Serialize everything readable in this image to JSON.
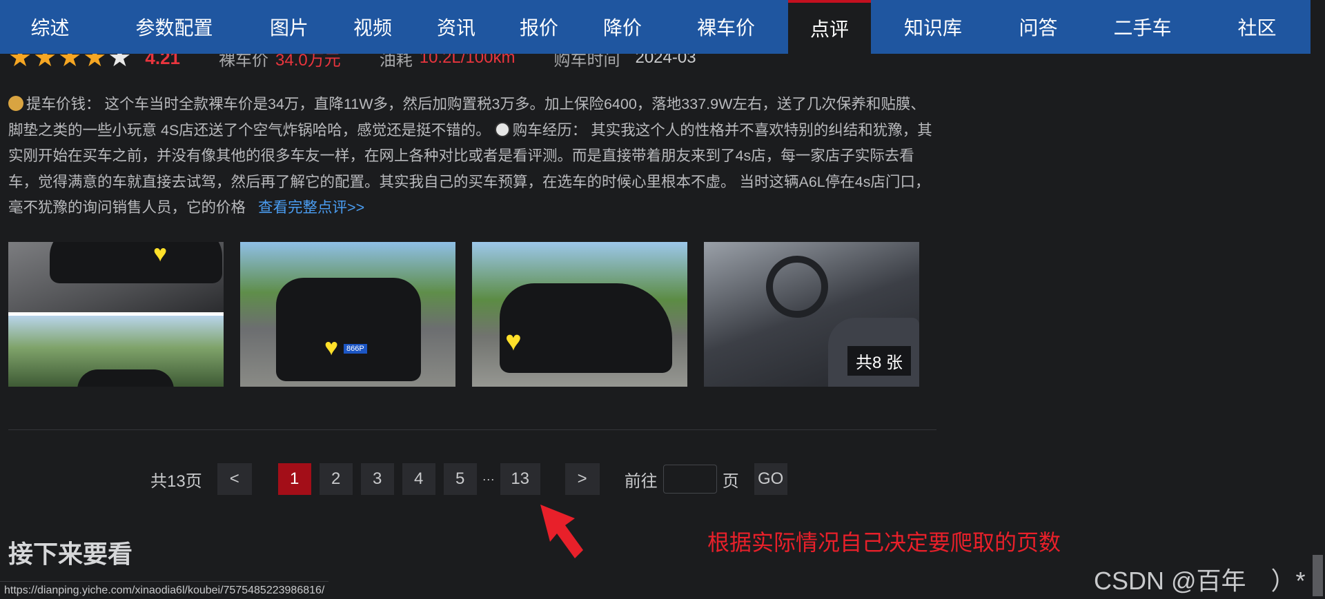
{
  "nav": {
    "items": [
      {
        "label": "综述",
        "width": 145
      },
      {
        "label": "参数配置",
        "width": 215
      },
      {
        "label": "图片",
        "width": 118
      },
      {
        "label": "视频",
        "width": 124
      },
      {
        "label": "资讯",
        "width": 118
      },
      {
        "label": "报价",
        "width": 122
      },
      {
        "label": "降价",
        "width": 120
      },
      {
        "label": "裸车价",
        "width": 180
      },
      {
        "label": "点评",
        "width": 120,
        "active": true
      },
      {
        "label": "知识库",
        "width": 180
      },
      {
        "label": "问答",
        "width": 125
      },
      {
        "label": "二手车",
        "width": 177
      },
      {
        "label": "社区",
        "width": 155
      }
    ]
  },
  "review": {
    "score": "4.21",
    "price_label": "裸车价",
    "price_value": "34.0万元",
    "fuel_label": "油耗",
    "fuel_value": "10.2L/100km",
    "date_label": "购车时间",
    "date_value": "2024-03",
    "text_part1": "提车价钱： 这个车当时全款裸车价是34万，直降11W多，然后加购置税3万多。加上保险6400，落地337.9W左右，送了几次保养和贴膜、脚垫之类的一些小玩意 4S店还送了个空气炸锅哈哈，感觉还是挺不错的。",
    "text_part2": "购车经历： 其实我这个人的性格并不喜欢特别的纠结和犹豫，其实刚开始在买车之前，并没有像其他的很多车友一样，在网上各种对比或者是看评测。而是直接带着朋友来到了4s店，每一家店子实际去看车，觉得满意的车就直接去试驾，然后再了解它的配置。其实我自己的买车预算，在选车的时候心里根本不虚。 当时这辆A6L停在4s店门口，毫不犹豫的询问销售人员，它的价格",
    "more_link": "查看完整点评>>",
    "photo_count": "共8 张",
    "plate_text": "866P"
  },
  "pagination": {
    "total": "共13页",
    "prev": "<",
    "pages": [
      "1",
      "2",
      "3",
      "4",
      "5"
    ],
    "ellipsis": "···",
    "last": "13",
    "next": ">",
    "goto_label": "前往",
    "page_unit": "页",
    "go": "GO"
  },
  "next_section_title": "接下来要看",
  "annotation_text": "根据实际情况自己决定要爬取的页数",
  "status_url": "https://dianping.yiche.com/xinaodia6l/koubei/7575485223986816/",
  "watermark": "CSDN @百年　）*",
  "colors": {
    "nav_bg": "#1f56a0",
    "active_top": "#c3101f",
    "star": "#f5a623",
    "red": "#e9353e",
    "link": "#4a9cf0",
    "page_current": "#a30e18",
    "annotation": "#e8202a"
  }
}
